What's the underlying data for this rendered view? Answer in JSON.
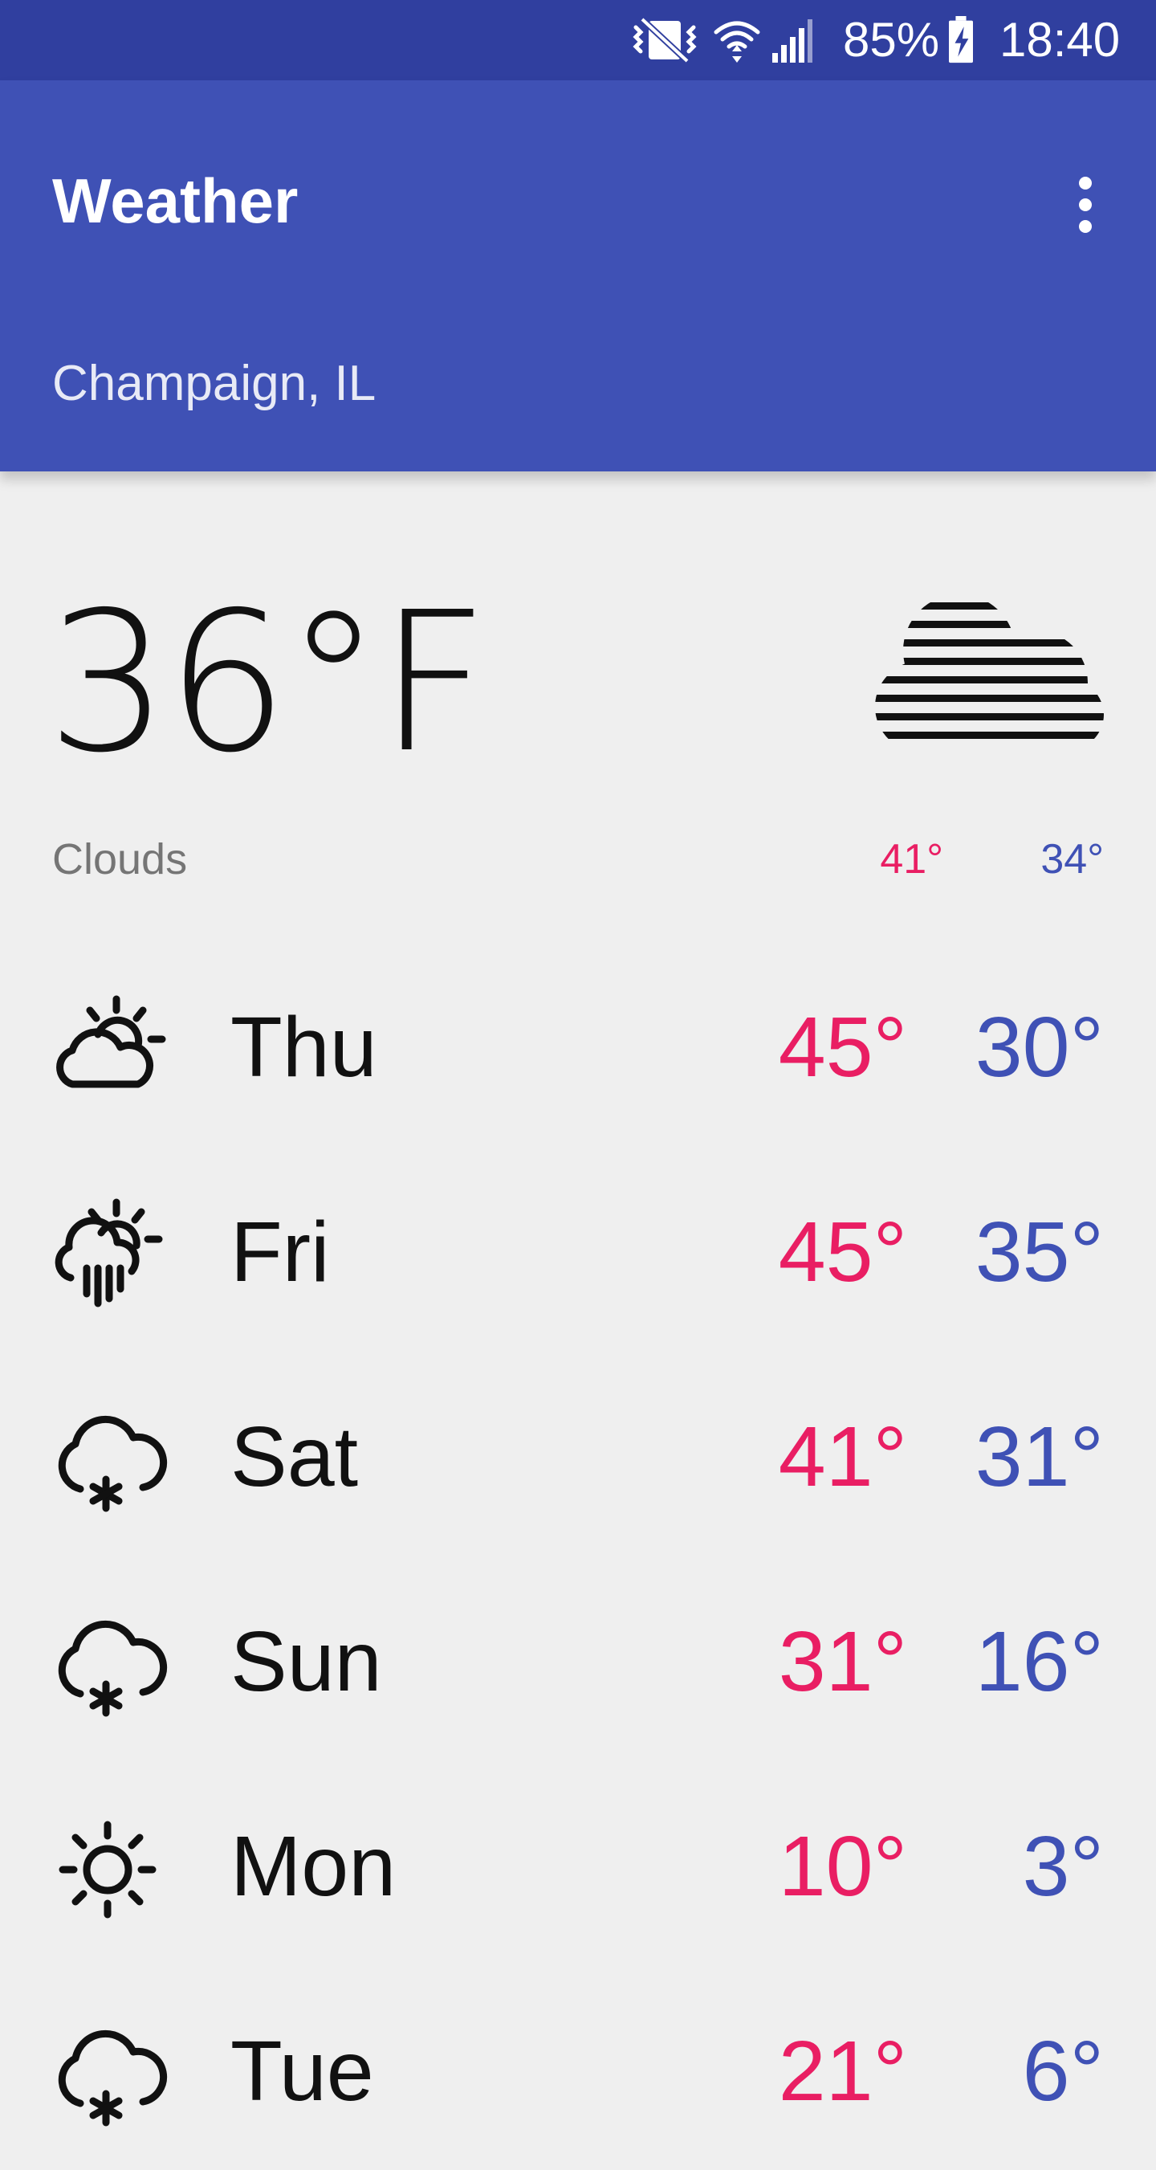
{
  "status_bar": {
    "battery": "85%",
    "time": "18:40",
    "icons": [
      "vibrate-icon",
      "wifi-icon",
      "signal-icon",
      "battery-charging-icon"
    ]
  },
  "app_bar": {
    "title": "Weather",
    "menu_icon": "more-vert-icon",
    "location": "Champaign, IL"
  },
  "current": {
    "temperature": "36°F",
    "condition": "Clouds",
    "high": "41°",
    "low": "34°",
    "icon": "clouds-icon"
  },
  "forecast": [
    {
      "day": "Thu",
      "high": "45°",
      "low": "30°",
      "icon": "partly-cloudy-icon"
    },
    {
      "day": "Fri",
      "high": "45°",
      "low": "35°",
      "icon": "sun-rain-icon"
    },
    {
      "day": "Sat",
      "high": "41°",
      "low": "31°",
      "icon": "snow-icon"
    },
    {
      "day": "Sun",
      "high": "31°",
      "low": "16°",
      "icon": "snow-icon"
    },
    {
      "day": "Mon",
      "high": "10°",
      "low": "3°",
      "icon": "sunny-icon"
    },
    {
      "day": "Tue",
      "high": "21°",
      "low": "6°",
      "icon": "snow-icon"
    }
  ],
  "colors": {
    "status_bar": "#303f9f",
    "app_bar": "#3f51b5",
    "high_temp": "#e91e63",
    "low_temp": "#3f51b5",
    "background": "#efefef"
  }
}
